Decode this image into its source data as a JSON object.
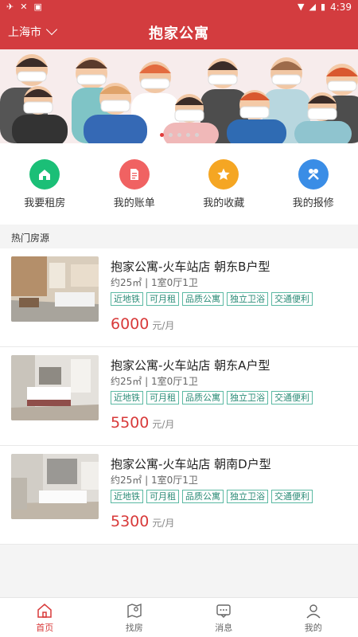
{
  "status_bar": {
    "time": "4:39"
  },
  "header": {
    "city": "上海市",
    "title": "抱家公寓"
  },
  "banner": {
    "slides": 5,
    "active_slide": 1
  },
  "actions": [
    {
      "label": "我要租房",
      "color": "#1bbf77",
      "icon": "home-icon"
    },
    {
      "label": "我的账单",
      "color": "#f06262",
      "icon": "bill-icon"
    },
    {
      "label": "我的收藏",
      "color": "#f5a623",
      "icon": "star-icon"
    },
    {
      "label": "我的报修",
      "color": "#3a8de6",
      "icon": "tools-icon"
    }
  ],
  "section": {
    "title": "热门房源"
  },
  "listings": [
    {
      "title": "抱家公寓-火车站店 朝东B户型",
      "sub": "约25㎡ | 1室0厅1卫",
      "tags": [
        "近地铁",
        "可月租",
        "品质公寓",
        "独立卫浴",
        "交通便利"
      ],
      "price": "6000",
      "unit": "元/月"
    },
    {
      "title": "抱家公寓-火车站店 朝东A户型",
      "sub": "约25㎡ | 1室0厅1卫",
      "tags": [
        "近地铁",
        "可月租",
        "品质公寓",
        "独立卫浴",
        "交通便利"
      ],
      "price": "5500",
      "unit": "元/月"
    },
    {
      "title": "抱家公寓-火车站店 朝南D户型",
      "sub": "约25㎡ | 1室0厅1卫",
      "tags": [
        "近地铁",
        "可月租",
        "品质公寓",
        "独立卫浴",
        "交通便利"
      ],
      "price": "5300",
      "unit": "元/月"
    }
  ],
  "tabs": [
    {
      "label": "首页",
      "icon": "home-icon",
      "active": true
    },
    {
      "label": "找房",
      "icon": "map-icon",
      "active": false
    },
    {
      "label": "消息",
      "icon": "message-icon",
      "active": false
    },
    {
      "label": "我的",
      "icon": "user-icon",
      "active": false
    }
  ],
  "colors": {
    "primary": "#d33c3f",
    "price": "#d83a3a",
    "tag": "#2a8b76"
  }
}
